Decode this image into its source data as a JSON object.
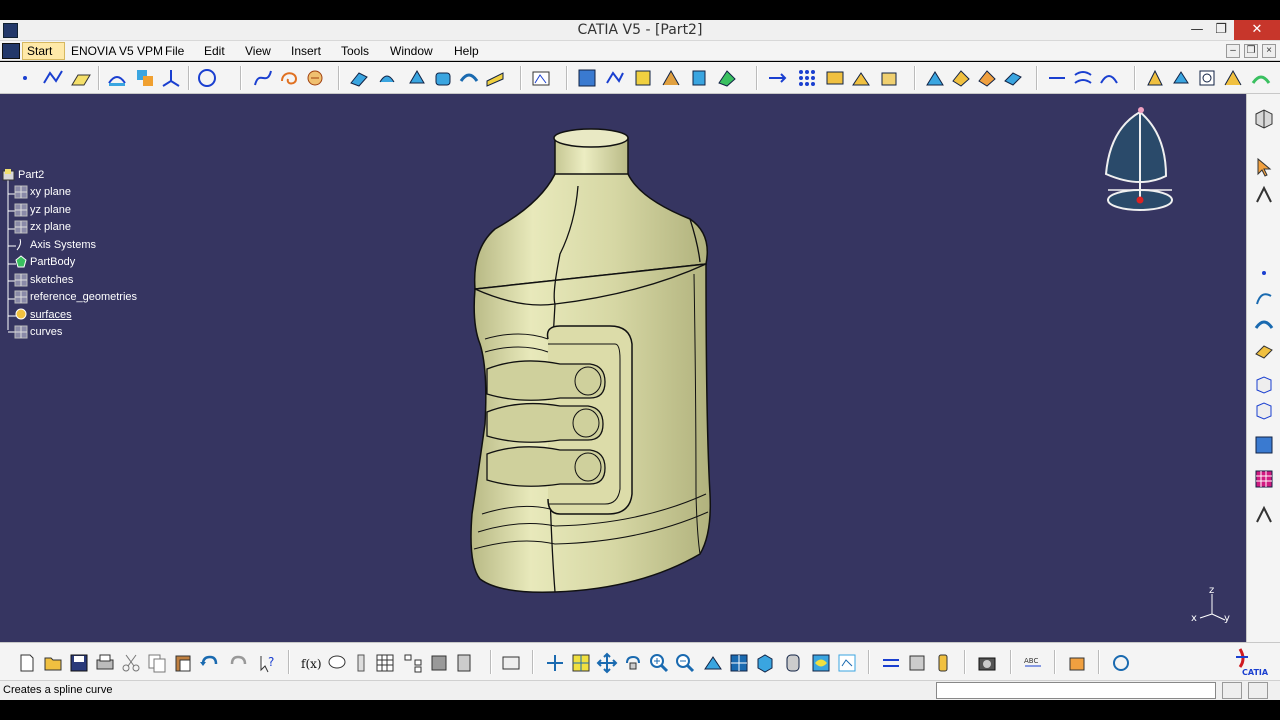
{
  "window": {
    "title": "CATIA V5 - [Part2]",
    "minimize": "—",
    "restore": "❐",
    "close": "✕"
  },
  "menubar": {
    "items": [
      "Start",
      "ENOVIA V5 VPM",
      "File",
      "Edit",
      "View",
      "Insert",
      "Tools",
      "Window",
      "Help"
    ]
  },
  "tree": {
    "items": [
      {
        "label": "Part2",
        "icon": "part-icon"
      },
      {
        "label": "xy plane",
        "icon": "plane-icon"
      },
      {
        "label": "yz plane",
        "icon": "plane-icon"
      },
      {
        "label": "zx plane",
        "icon": "plane-icon"
      },
      {
        "label": "Axis Systems",
        "icon": "axis-system-icon"
      },
      {
        "label": "PartBody",
        "icon": "partbody-icon"
      },
      {
        "label": "sketches",
        "icon": "geometrical-set-icon"
      },
      {
        "label": "reference_geometries",
        "icon": "geometrical-set-icon"
      },
      {
        "label": "surfaces",
        "icon": "geometrical-set-icon"
      },
      {
        "label": "curves",
        "icon": "geometrical-set-icon"
      }
    ]
  },
  "axis_triad": {
    "x": "x",
    "y": "y",
    "z": "z"
  },
  "brand": {
    "logo_text": "CATIA"
  },
  "status": {
    "message": "Creates a spline curve",
    "command_value": ""
  },
  "colors": {
    "viewport_bg": "#363561",
    "part_surface": "#d6d7a4",
    "compass_fill": "#2a4a6a",
    "toolbar_bg": "#f4f4f4"
  }
}
